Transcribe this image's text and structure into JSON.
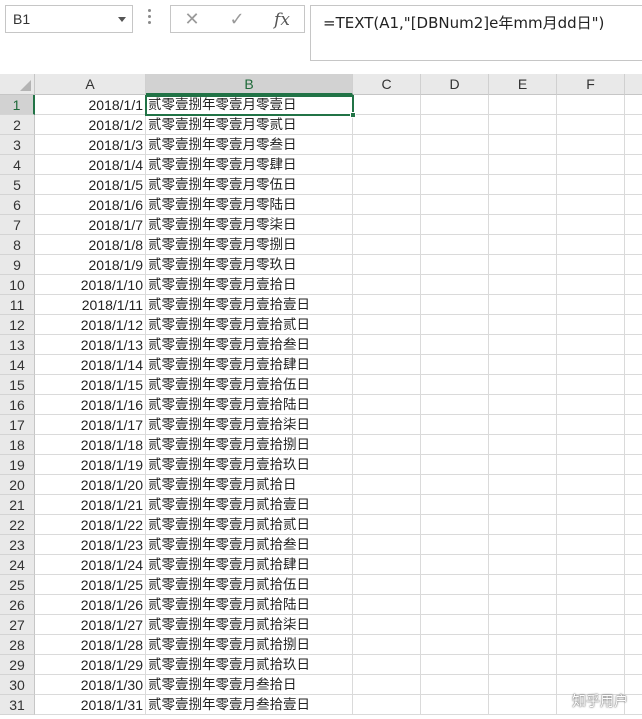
{
  "name_box": {
    "value": "B1"
  },
  "formula_bar": {
    "cancel_icon": "close-icon",
    "enter_icon": "check-icon",
    "fx_label": "fx",
    "formula": "=TEXT(A1,\"[DBNum2]e年mm月dd日\")"
  },
  "columns": [
    "A",
    "B",
    "C",
    "D",
    "E",
    "F"
  ],
  "selected_cell": "B1",
  "rows": [
    {
      "n": "1",
      "a": "2018/1/1",
      "b": "贰零壹捌年零壹月零壹日"
    },
    {
      "n": "2",
      "a": "2018/1/2",
      "b": "贰零壹捌年零壹月零贰日"
    },
    {
      "n": "3",
      "a": "2018/1/3",
      "b": "贰零壹捌年零壹月零叁日"
    },
    {
      "n": "4",
      "a": "2018/1/4",
      "b": "贰零壹捌年零壹月零肆日"
    },
    {
      "n": "5",
      "a": "2018/1/5",
      "b": "贰零壹捌年零壹月零伍日"
    },
    {
      "n": "6",
      "a": "2018/1/6",
      "b": "贰零壹捌年零壹月零陆日"
    },
    {
      "n": "7",
      "a": "2018/1/7",
      "b": "贰零壹捌年零壹月零柒日"
    },
    {
      "n": "8",
      "a": "2018/1/8",
      "b": "贰零壹捌年零壹月零捌日"
    },
    {
      "n": "9",
      "a": "2018/1/9",
      "b": "贰零壹捌年零壹月零玖日"
    },
    {
      "n": "10",
      "a": "2018/1/10",
      "b": "贰零壹捌年零壹月壹拾日"
    },
    {
      "n": "11",
      "a": "2018/1/11",
      "b": "贰零壹捌年零壹月壹拾壹日"
    },
    {
      "n": "12",
      "a": "2018/1/12",
      "b": "贰零壹捌年零壹月壹拾贰日"
    },
    {
      "n": "13",
      "a": "2018/1/13",
      "b": "贰零壹捌年零壹月壹拾叁日"
    },
    {
      "n": "14",
      "a": "2018/1/14",
      "b": "贰零壹捌年零壹月壹拾肆日"
    },
    {
      "n": "15",
      "a": "2018/1/15",
      "b": "贰零壹捌年零壹月壹拾伍日"
    },
    {
      "n": "16",
      "a": "2018/1/16",
      "b": "贰零壹捌年零壹月壹拾陆日"
    },
    {
      "n": "17",
      "a": "2018/1/17",
      "b": "贰零壹捌年零壹月壹拾柒日"
    },
    {
      "n": "18",
      "a": "2018/1/18",
      "b": "贰零壹捌年零壹月壹拾捌日"
    },
    {
      "n": "19",
      "a": "2018/1/19",
      "b": "贰零壹捌年零壹月壹拾玖日"
    },
    {
      "n": "20",
      "a": "2018/1/20",
      "b": "贰零壹捌年零壹月贰拾日"
    },
    {
      "n": "21",
      "a": "2018/1/21",
      "b": "贰零壹捌年零壹月贰拾壹日"
    },
    {
      "n": "22",
      "a": "2018/1/22",
      "b": "贰零壹捌年零壹月贰拾贰日"
    },
    {
      "n": "23",
      "a": "2018/1/23",
      "b": "贰零壹捌年零壹月贰拾叁日"
    },
    {
      "n": "24",
      "a": "2018/1/24",
      "b": "贰零壹捌年零壹月贰拾肆日"
    },
    {
      "n": "25",
      "a": "2018/1/25",
      "b": "贰零壹捌年零壹月贰拾伍日"
    },
    {
      "n": "26",
      "a": "2018/1/26",
      "b": "贰零壹捌年零壹月贰拾陆日"
    },
    {
      "n": "27",
      "a": "2018/1/27",
      "b": "贰零壹捌年零壹月贰拾柒日"
    },
    {
      "n": "28",
      "a": "2018/1/28",
      "b": "贰零壹捌年零壹月贰拾捌日"
    },
    {
      "n": "29",
      "a": "2018/1/29",
      "b": "贰零壹捌年零壹月贰拾玖日"
    },
    {
      "n": "30",
      "a": "2018/1/30",
      "b": "贰零壹捌年零壹月叁拾日"
    },
    {
      "n": "31",
      "a": "2018/1/31",
      "b": "贰零壹捌年零壹月叁拾壹日"
    }
  ],
  "watermark": "知乎用户",
  "colors": {
    "accent": "#217346",
    "header_bg": "#e9e9e9",
    "header_selected_bg": "#d2d2d2",
    "gridline": "#dadada"
  }
}
